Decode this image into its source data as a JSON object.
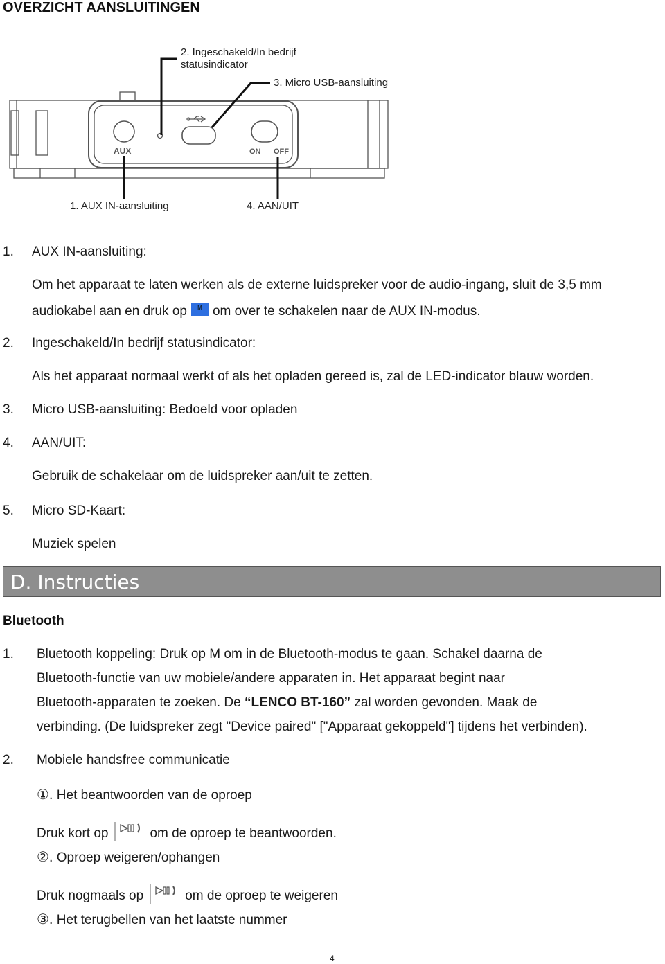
{
  "page": {
    "title": "OVERZICHT AANSLUITINGEN",
    "page_number": "4"
  },
  "diagram": {
    "callouts": {
      "c2_line1": "2. Ingeschakeld/In bedrijf",
      "c2_line2": "statusindicator",
      "c3": "3. Micro USB-aansluiting",
      "c1": "1. AUX IN-aansluiting",
      "c4": "4. AAN/UIT"
    },
    "device_labels": {
      "aux": "AUX",
      "on": "ON",
      "off": "OFF"
    }
  },
  "connections": [
    {
      "num": "1.",
      "heading": "AUX IN-aansluiting:",
      "text_line1": "Om het apparaat te laten werken als de externe luidspreker voor de audio-ingang, sluit de 3,5 mm",
      "text_line2_before": "audiokabel aan en druk op",
      "icon_label": "M",
      "text_line2_after": "om over te schakelen naar de AUX IN-modus."
    },
    {
      "num": "2.",
      "heading": "Ingeschakeld/In bedrijf statusindicator:",
      "text": "Als het apparaat normaal werkt of als het opladen gereed is, zal de LED-indicator blauw worden."
    },
    {
      "num": "3.",
      "heading": "Micro USB-aansluiting: Bedoeld voor opladen"
    },
    {
      "num": "4.",
      "heading": "AAN/UIT:",
      "text": "Gebruik de schakelaar om de luidspreker aan/uit te zetten."
    },
    {
      "num": "5.",
      "heading": "Micro SD-Kaart:",
      "text": "Muziek spelen"
    }
  ],
  "section": {
    "title": "D.  Instructies",
    "sub_heading": "Bluetooth",
    "colors": {
      "bar": "#8e8e8e",
      "m_button": "#2e6fe0"
    }
  },
  "bluetooth": {
    "item1": {
      "num": "1.",
      "line1": "Bluetooth koppeling: Druk op M om in de Bluetooth-modus te gaan. Schakel daarna de",
      "line2": "Bluetooth-functie van uw mobiele/andere apparaten in. Het apparaat begint naar",
      "line3_before": "Bluetooth-apparaten te zoeken. De ",
      "line3_bold": "“LENCO BT-160”",
      "line3_after": " zal worden gevonden. Maak de",
      "line4": "verbinding. (De luidspreker zegt \"Device paired\" [\"Apparaat gekoppeld\"] tijdens het verbinden)."
    },
    "item2": {
      "num": "2.",
      "heading": "Mobiele handsfree communicatie",
      "subitems": [
        {
          "marker": "①.",
          "title": "Het beantwoorden van de oproep",
          "instr_before": "Druk kort op",
          "instr_after": "om de oproep te beantwoorden."
        },
        {
          "marker": "②.",
          "title": "Oproep weigeren/ophangen",
          "instr_before": "Druk nogmaals op",
          "instr_after": "om de oproep te weigeren"
        },
        {
          "marker": "③.",
          "title": "Het terugbellen van het laatste nummer"
        }
      ]
    }
  }
}
